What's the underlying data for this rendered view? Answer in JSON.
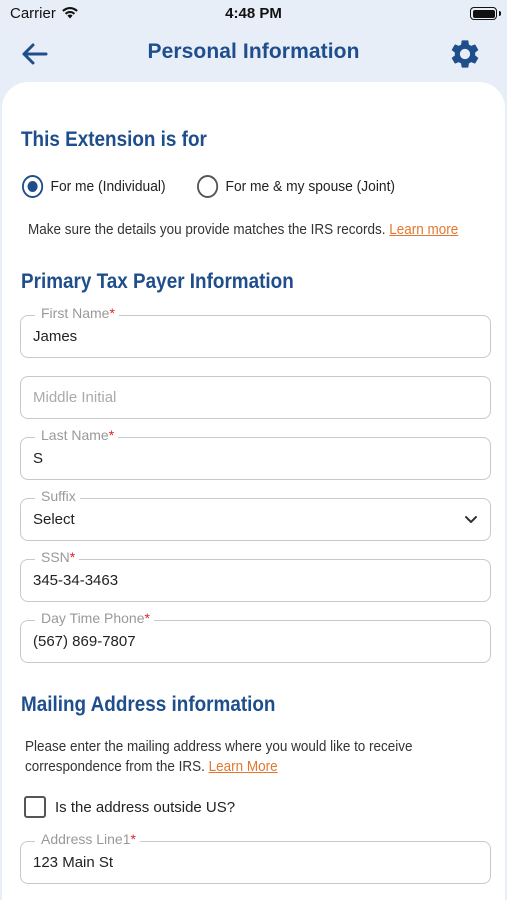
{
  "status_bar": {
    "carrier": "Carrier",
    "time": "4:48 PM"
  },
  "nav": {
    "title": "Personal Information"
  },
  "extension": {
    "title": "This Extension is for",
    "options": [
      {
        "label": "For me (Individual)",
        "selected": true
      },
      {
        "label": "For me & my spouse (Joint)",
        "selected": false
      }
    ],
    "note": "Make sure the details you provide matches the IRS records.",
    "learn_more": "Learn more"
  },
  "primary": {
    "title": "Primary Tax Payer Information",
    "first_name": {
      "label": "First Name",
      "required": "*",
      "value": "James"
    },
    "middle_initial": {
      "placeholder": "Middle Initial"
    },
    "last_name": {
      "label": "Last Name",
      "required": "*",
      "value": "S"
    },
    "suffix": {
      "label": "Suffix",
      "value": "Select"
    },
    "ssn": {
      "label": "SSN",
      "required": "*",
      "value": "345-34-3463"
    },
    "phone": {
      "label": "Day Time Phone",
      "required": "*",
      "value": "(567) 869-7807"
    }
  },
  "mailing": {
    "title": "Mailing Address information",
    "note_line1": "Please enter the mailing address where you would like to receive",
    "note_line2": "correspondence from the IRS.",
    "learn_more": "Learn More",
    "outside_us_label": "Is the address outside US?",
    "outside_us_checked": false,
    "address_line1": {
      "label": "Address Line1",
      "required": "*",
      "value": "123 Main St"
    }
  },
  "colors": {
    "accent": "#1f4e8c",
    "link": "#e4772f",
    "required": "#e02424",
    "background": "#e8eef7"
  }
}
